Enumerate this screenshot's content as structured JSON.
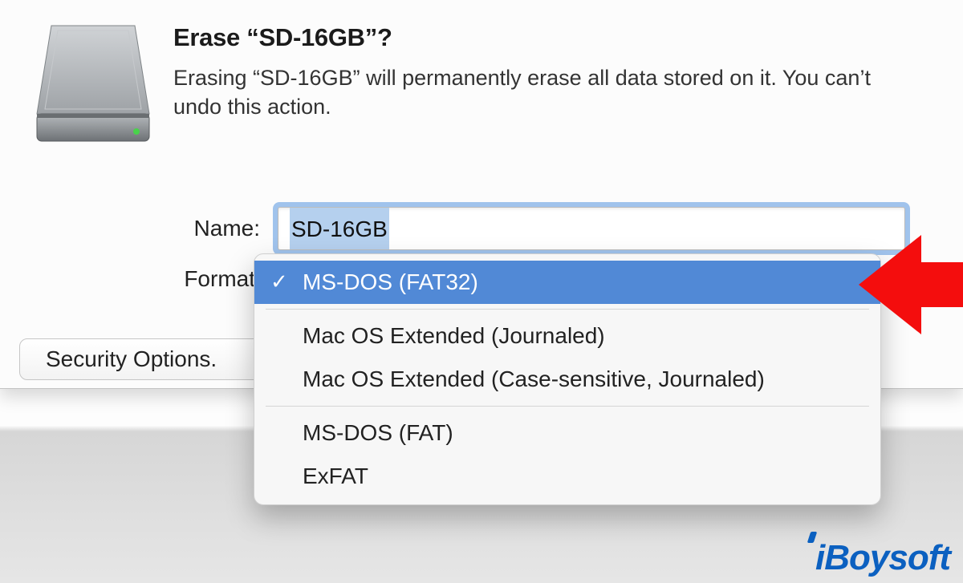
{
  "dialog": {
    "title": "Erase “SD-16GB”?",
    "subtitle": "Erasing “SD-16GB” will permanently erase all data stored on it. You can’t undo this action.",
    "name_label": "Name:",
    "format_label": "Format",
    "name_value": "SD-16GB",
    "security_button": "Security Options."
  },
  "format_dropdown": {
    "selected_index": 0,
    "options": [
      "MS-DOS (FAT32)",
      "Mac OS Extended (Journaled)",
      "Mac OS Extended (Case-sensitive, Journaled)",
      "MS-DOS (FAT)",
      "ExFAT"
    ]
  },
  "icons": {
    "drive": "external-drive-icon",
    "checkmark": "✓"
  },
  "colors": {
    "selection_row": "#5189d6",
    "focus_ring": "#5493df",
    "arrow": "#f40d0d",
    "brand": "#0b60c0"
  },
  "watermark": "iBoysoft"
}
